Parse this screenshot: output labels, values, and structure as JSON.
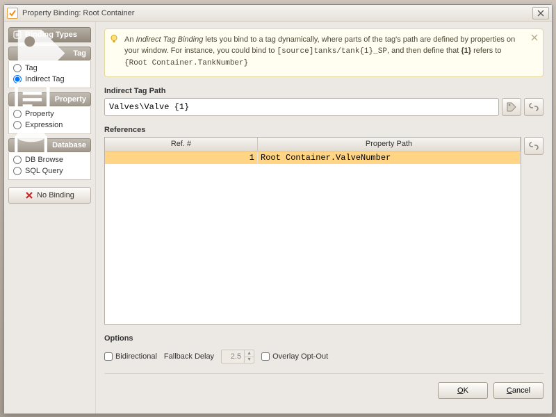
{
  "window": {
    "title": "Property Binding: Root Container"
  },
  "sidebar": {
    "header": "Binding Types",
    "groups": [
      {
        "title": "Tag",
        "options": [
          {
            "label": "Tag",
            "selected": false
          },
          {
            "label": "Indirect Tag",
            "selected": true
          }
        ]
      },
      {
        "title": "Property",
        "options": [
          {
            "label": "Property",
            "selected": false
          },
          {
            "label": "Expression",
            "selected": false
          }
        ]
      },
      {
        "title": "Database",
        "options": [
          {
            "label": "DB Browse",
            "selected": false
          },
          {
            "label": "SQL Query",
            "selected": false
          }
        ]
      }
    ],
    "noBinding": "No Binding"
  },
  "help": {
    "pre": "An ",
    "em": "Indirect Tag Binding",
    "mid1": " lets you bind to a tag dynamically, where parts of the tag's path are defined by properties on your window. For instance, you could bind to ",
    "code1": "[source]tanks/tank{1}_SP",
    "mid2": ", and then define that ",
    "bold1": "{1}",
    "mid3": " refers to ",
    "code2": "{Root Container.TankNumber}"
  },
  "labels": {
    "indirectPath": "Indirect Tag Path",
    "references": "References",
    "options": "Options",
    "bidirectional": "Bidirectional",
    "fallbackDelay": "Fallback Delay",
    "overlayOptOut": "Overlay Opt-Out",
    "ok": "OK",
    "cancel": "Cancel"
  },
  "pathValue": "Valves\\Valve {1}",
  "table": {
    "headers": {
      "ref": "Ref. #",
      "pp": "Property Path"
    },
    "rows": [
      {
        "ref": "1",
        "pp": "Root Container.ValveNumber",
        "selected": true
      }
    ]
  },
  "options": {
    "bidirectional": false,
    "fallbackDelay": "2.5",
    "overlayOptOut": false
  }
}
